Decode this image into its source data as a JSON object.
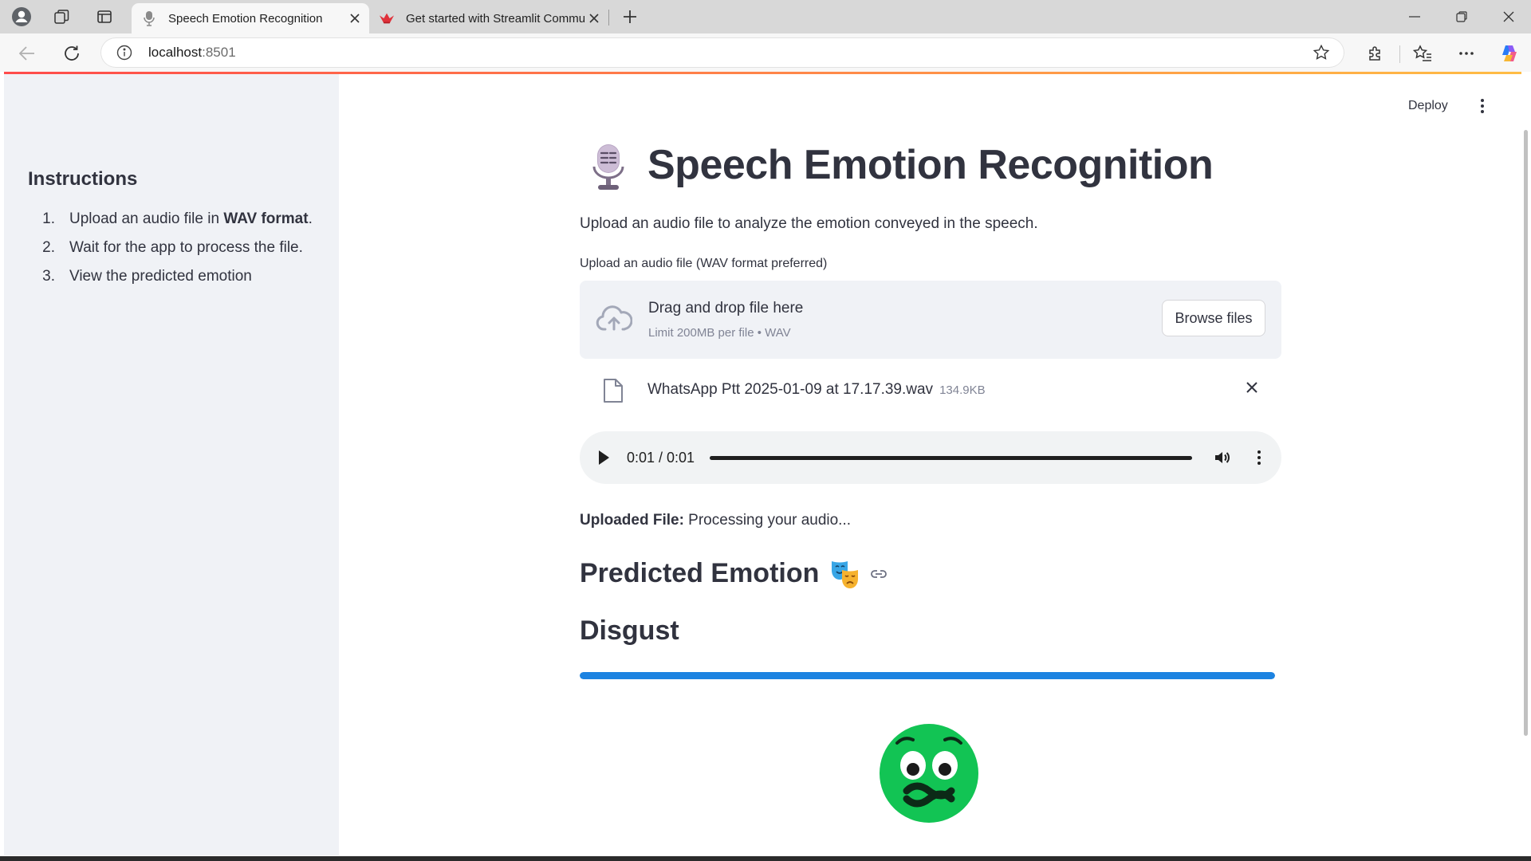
{
  "browser": {
    "tabs": [
      {
        "title": "Speech Emotion Recognition",
        "favicon": "microphone-icon",
        "active": true
      },
      {
        "title": "Get started with Streamlit Commu",
        "favicon": "streamlit-crown-icon",
        "active": false
      }
    ],
    "address": {
      "host": "localhost",
      "port": ":8501"
    }
  },
  "header": {
    "deploy_label": "Deploy"
  },
  "sidebar": {
    "title": "Instructions",
    "steps": [
      {
        "num": "1.",
        "pre": "Upload an audio file in ",
        "bold": "WAV format",
        "post": "."
      },
      {
        "num": "2.",
        "text": "Wait for the app to process the file."
      },
      {
        "num": "3.",
        "text": "View the predicted emotion"
      }
    ]
  },
  "main": {
    "title": "Speech Emotion Recognition",
    "title_icon": "microphone-icon",
    "subtitle": "Upload an audio file to analyze the emotion conveyed in the speech.",
    "uploader": {
      "label": "Upload an audio file (WAV format preferred)",
      "drop_text": "Drag and drop file here",
      "limit_text": "Limit 200MB per file • WAV",
      "browse_label": "Browse files"
    },
    "file": {
      "name": "WhatsApp Ptt 2025-01-09 at 17.17.39.wav",
      "size": "134.9KB"
    },
    "audio": {
      "time": "0:01 / 0:01",
      "progress": 1.0
    },
    "uploaded": {
      "label": "Uploaded File:",
      "text": " Processing your audio..."
    },
    "predicted_heading": "Predicted Emotion",
    "emotion": "Disgust",
    "confidence_progress": 1.0,
    "emotion_icon": "nauseated-face-icon"
  },
  "colors": {
    "accent_blue": "#1c83e1",
    "sidebar_bg": "#f0f2f6",
    "text": "#31333f",
    "face_green": "#12c454"
  }
}
